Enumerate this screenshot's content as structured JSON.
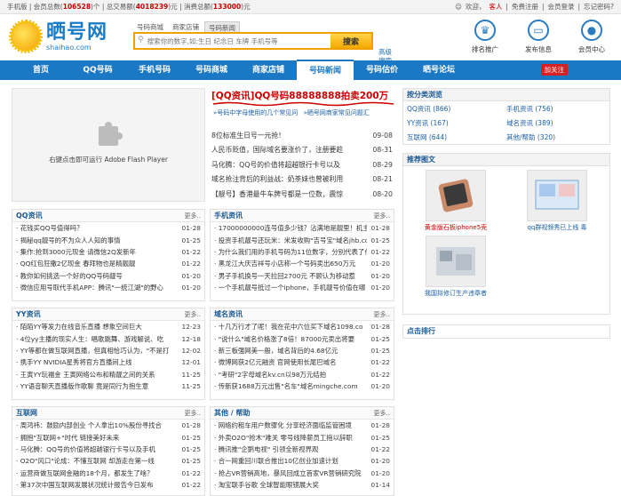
{
  "topbar": {
    "mobile": "手机版",
    "members_label": "会员总数(",
    "members": "106528",
    "members_unit": ")个",
    "deals_label": "总交易额(",
    "deals": "4018239",
    "deals_unit": ")元",
    "consume_label": "消费总额(",
    "consume": "133000",
    "consume_unit": ")元",
    "welcome": "欢迎，",
    "guest": "客人",
    "register": "免费注册",
    "login": "会员登录",
    "forgot": "忘记密码?"
  },
  "logo": {
    "cn": "晒号网",
    "en": "shaihao.com"
  },
  "search": {
    "tabs": [
      "号码商城",
      "商家店铺",
      "号码新闻"
    ],
    "placeholder": "搜索你的数字,如:生日 纪念日 车牌 手机号等",
    "button": "搜索",
    "advanced": [
      "高级",
      "搜索"
    ]
  },
  "header_icons": [
    {
      "name": "ranking-icon",
      "label": "排名推广",
      "glyph": "♛"
    },
    {
      "name": "publish-icon",
      "label": "发布信息",
      "glyph": "▭"
    },
    {
      "name": "member-icon",
      "label": "会员中心",
      "glyph": "●"
    }
  ],
  "nav": {
    "items": [
      "首页",
      "QQ号码",
      "手机号码",
      "号码商城",
      "商家店铺",
      "号码新闻",
      "号码估价",
      "晒号论坛"
    ],
    "active": 5,
    "follow": "加关注"
  },
  "flash": {
    "text": "右键点击即可运行 Adobe Flash Player"
  },
  "headline": {
    "title": "[QQ资讯]QQ号码88888888拍卖200万",
    "sub1": "»号码中字母使用的几个常见问",
    "sub2": "»晒号网商家常见问题汇"
  },
  "headline_news": [
    {
      "t": "8位标准生日号一元抢！",
      "d": "09-08"
    },
    {
      "t": "人民币贬值，国际域名要涨价了，注册要趁",
      "d": "08-31"
    },
    {
      "t": "马化腾：QQ号的价值将超越银行卡号以及",
      "d": "08-29"
    },
    {
      "t": "域名抢注背后的利益战：奶茶妹也曾被利用",
      "d": "08-21"
    },
    {
      "t": "【靓号】香港最牛车牌号都是一位数，震惊",
      "d": "08-20"
    }
  ],
  "boxes": {
    "more": "更多..",
    "qq": {
      "title": "QQ资讯",
      "items": [
        {
          "t": "· 花钱买QQ号值得吗？",
          "d": "01-28"
        },
        {
          "t": "· 揭秘qq靓号的不为众人人知的事情",
          "d": "01-25"
        },
        {
          "t": "· 集作:抢到3000元现金 请微信2Q发新年",
          "d": "01-22"
        },
        {
          "t": "· QQ红包狂撒2亿现金 春拜物也是精靓靓",
          "d": "01-22"
        },
        {
          "t": "· 教你如何挑选一个好的QQ号码靓号",
          "d": "01-20"
        },
        {
          "t": "· 微信应用号取代手机APP：腾讯\"一统江湖\"的野心",
          "d": "01-20"
        }
      ]
    },
    "phone": {
      "title": "手机资讯",
      "items": [
        {
          "t": "· 17000000000连号值多少钱？沾满地是靓里！机主",
          "d": "01-28"
        },
        {
          "t": "· 投资手机靓号还玩米：米发收购\"吉号宝\"域名jhb.cc",
          "d": "01-25"
        },
        {
          "t": "· 为什么我们用的手机号码为11位数字，分别代表了什",
          "d": "01-22"
        },
        {
          "t": "· 黑龙江大庆吉祥号小店称一个号码卖出650万元",
          "d": "01-20"
        },
        {
          "t": "· 男子手机换号一天拉回2700元 不顾认为移动惹",
          "d": "01-20"
        },
        {
          "t": "· 一个手机靓号抵过一个iphone，手机靓号价值在哪",
          "d": "01-20"
        }
      ]
    },
    "yy": {
      "title": "YY资讯",
      "items": [
        {
          "t": "· 陌陌YY等发力在线音乐直播 想象空间巨大",
          "d": "12-23"
        },
        {
          "t": "· 4位yy主播的现实人生：唱歌跳舞、游戏解说、吃",
          "d": "12-18"
        },
        {
          "t": "· YY等都在做互联网直播，但真相恰巧认为，\"不是打",
          "d": "12-02"
        },
        {
          "t": "· 携手YY NVIDIA星秀将官方直播间上线",
          "d": "12-01"
        },
        {
          "t": "· 王寅YY玩福金 王寅网络公布和精靓之间的关系",
          "d": "11-25"
        },
        {
          "t": "· YY语音聊天直播版作歌聊 竟是同行为抱生意",
          "d": "11-25"
        }
      ]
    },
    "domain": {
      "title": "域名资讯",
      "items": [
        {
          "t": "· 十几万行才了呢！我在花中六位买下域名1098.co",
          "d": "01-28"
        },
        {
          "t": "· \"说什么\"域名价格涨了8倍！87000元卖出将要",
          "d": "01-25"
        },
        {
          "t": "· 新三板强网美一般，域名背后的4.68亿元",
          "d": "01-25"
        },
        {
          "t": "· 微博网获2亿元融资 官网使用长尾巴域名",
          "d": "01-22"
        },
        {
          "t": "· \"考研\"2字母域名kv.cn以98万元结拍",
          "d": "01-22"
        },
        {
          "t": "· 传新获1688万元出售\"名车\"域名mingche.com",
          "d": "01-20"
        }
      ]
    },
    "internet": {
      "title": "互联网",
      "items": [
        {
          "t": "· 周鸿祎：鼓励内部创业 个人拿出10%股份寻找合",
          "d": "01-28"
        },
        {
          "t": "· 拥抱\"互联网+\"时代 链接美好未来",
          "d": "01-25"
        },
        {
          "t": "· 马化腾：QQ号的价值将超越银行卡号以及手机",
          "d": "01-25"
        },
        {
          "t": "· O2O\"风口\"论成：不懂互联网 却游走在第一线",
          "d": "01-25"
        },
        {
          "t": "· 运营商做互联网金融的18个月，都发生了啥？",
          "d": "01-22"
        },
        {
          "t": "· 第37次中国互联网发展状况统计报告今日发布",
          "d": "01-22"
        }
      ]
    },
    "other": {
      "title": "其他 / 帮助",
      "items": [
        {
          "t": "· 网络约租车用户数骤化 分享经济面临监管困境",
          "d": "01-28"
        },
        {
          "t": "· 外卖O2O\"抢木\"难关 零号线降薪员工拖以辞职",
          "d": "01-25"
        },
        {
          "t": "· 腾讯推\"企鹅电视\" 引领全新视界观",
          "d": "01-22"
        },
        {
          "t": "· 合一网重回川联合推出10亿创业加速计划",
          "d": "01-20"
        },
        {
          "t": "· 抢占VR营销高地，暴风回成立首家VR营销研究院",
          "d": "01-20"
        },
        {
          "t": "· 淘宝联手谷歌 全球智能眼镜展大奖",
          "d": "01-14"
        }
      ]
    }
  },
  "sidebar": {
    "category_title": "按分类浏览",
    "categories": [
      {
        "t": "QQ资讯 (866)"
      },
      {
        "t": "手机资讯 (756)"
      },
      {
        "t": "YY资讯 (167)"
      },
      {
        "t": "域名资讯 (389)"
      },
      {
        "t": "互联网 (644)"
      },
      {
        "t": "其他/帮助 (320)"
      }
    ],
    "pics_title": "推荐图文",
    "pics": [
      {
        "cap": "黄金版石板iphone5壳"
      },
      {
        "cap": "qq群视频秀已上线 毒"
      },
      {
        "cap": "我国拟修订生产违章者"
      }
    ],
    "rank_title": "点击排行"
  }
}
